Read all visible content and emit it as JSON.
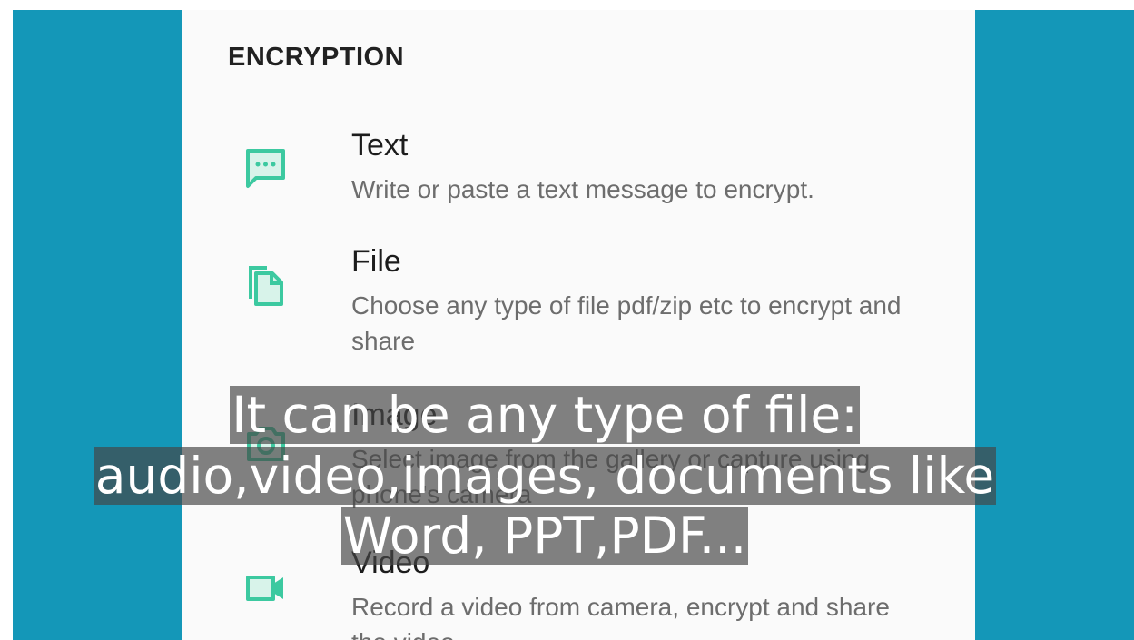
{
  "section": {
    "title": "ENCRYPTION"
  },
  "items": [
    {
      "title": "Text",
      "description": "Write or paste a text message to encrypt.",
      "icon": "message-icon"
    },
    {
      "title": "File",
      "description": "Choose any type of file pdf/zip etc to encrypt and share",
      "icon": "file-copy-icon"
    },
    {
      "title": "Image",
      "description": "Select image from the gallery or capture using phone's camera",
      "icon": "camera-icon"
    },
    {
      "title": "Video",
      "description": "Record a video from camera, encrypt and share the video",
      "icon": "video-camera-icon"
    }
  ],
  "caption": {
    "line1": "It can be any type of file:",
    "line2": "audio,video,images, documents like",
    "line3": "Word, PPT,PDF..."
  },
  "colors": {
    "background": "#1497b8",
    "accent": "#3cc9a0",
    "panel": "#fafafa"
  }
}
